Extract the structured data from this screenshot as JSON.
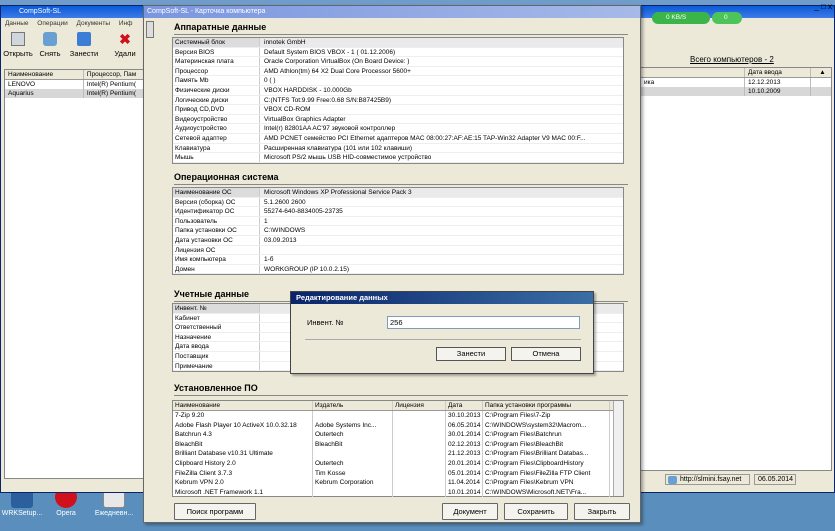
{
  "desktop": {
    "icons": [
      {
        "label": "WRKSetup...",
        "color": "#2c5f9e",
        "icon": "setup-icon"
      },
      {
        "label": "Opera",
        "color": "#d0101a",
        "icon": "opera-icon"
      },
      {
        "label": "Ежедневн...",
        "color": "#e8e8e8",
        "icon": "notepad-icon"
      }
    ]
  },
  "main": {
    "title": "CompSoft-SL",
    "menu": [
      "Данные",
      "Операции",
      "Документы",
      "Инф"
    ],
    "toolbar": [
      "Открыть",
      "Снять",
      "Занести",
      "Удали"
    ],
    "grid": {
      "headers": [
        "Наименование",
        "Процессор, Пам"
      ],
      "rows": [
        [
          "LENOVO",
          "Intel(R) Pentium("
        ],
        [
          "Aquarius",
          "Intel(R) Pentium("
        ]
      ]
    },
    "right_grid": {
      "headers": [
        "",
        "Дата ввода"
      ],
      "rows": [
        [
          "ика",
          "12.12.2013"
        ],
        [
          "",
          "10.10.2009"
        ]
      ]
    },
    "speed": "0 KB/S",
    "speed2": "0",
    "total_link": "Всего компьютеров - 2",
    "status_url": "http://slmini.fsay.net",
    "status_date": "06.05.2014",
    "window_controls": "_ □ x"
  },
  "card": {
    "title": "CompSoft-SL - Карточка компьютера",
    "hardware": {
      "title": "Аппаратные данные",
      "rows": [
        [
          "Системный блок",
          "innotek GmbH"
        ],
        [
          "Версия BIOS",
          "Default System BIOS VBOX  - 1 ( 01.12.2006)"
        ],
        [
          "Материнская плата",
          "Oracle Corporation VirtualBox (On Board Device: )"
        ],
        [
          "Процессор",
          "AMD Athlon(tm) 64 X2 Dual Core Processor 5600+"
        ],
        [
          "Память Mb",
          "0 ( )"
        ],
        [
          "Физические диски",
          "VBOX HARDDISK - 10.000Gb"
        ],
        [
          "Логические диски",
          "C:(NTFS Tot:9.99 Free:0.68 S/N:B87425B9)"
        ],
        [
          "Привод CD,DVD",
          "VBOX CD-ROM"
        ],
        [
          "Видеоустройство",
          "VirtualBox Graphics Adapter"
        ],
        [
          "Аудиоустройство",
          "Intel(r) 82801AA AC'97 звуковой контроллер"
        ],
        [
          "Сетевой адаптер",
          "AMD PCNET семейство PCI Ethernet адаптеров MAC 08:00:27:AF:AE:15  TAP-Win32 Adapter V9 MAC 00:F..."
        ],
        [
          "Клавиатура",
          "Расширенная клавиатура (101 или 102 клавиши)"
        ],
        [
          "Мышь",
          "Microsoft PS/2 мышь  USB HID-совместимое устройство"
        ]
      ]
    },
    "os": {
      "title": "Операционная система",
      "rows": [
        [
          "Наименование ОС",
          "Microsoft Windows XP Professional Service Pack 3"
        ],
        [
          "Версия (сборка) ОС",
          "5.1.2600 2600"
        ],
        [
          "Идентификатор ОС",
          "55274-640-8834005-23735"
        ],
        [
          "Пользователь",
          "1"
        ],
        [
          "Папка установки ОС",
          "C:\\WINDOWS"
        ],
        [
          "Дата установки ОС",
          "03.09.2013"
        ],
        [
          "Лицензия ОС",
          ""
        ],
        [
          "Имя компьютера",
          "1-б"
        ],
        [
          "Домен",
          "WORKGROUP (IP 10.0.2.15)"
        ]
      ]
    },
    "account": {
      "title": "Учетные данные",
      "rows": [
        [
          "Инвент. №",
          ""
        ],
        [
          "Кабинет",
          ""
        ],
        [
          "Ответственный",
          ""
        ],
        [
          "Назначение",
          ""
        ],
        [
          "Дата ввода",
          ""
        ],
        [
          "Поставщик",
          ""
        ],
        [
          "Примечание",
          ""
        ]
      ]
    },
    "software": {
      "title": "Установленное ПО",
      "headers": [
        "Наименование",
        "Издатель",
        "Лицензия",
        "Дата",
        "Папка установки программы"
      ],
      "rows": [
        [
          "7-Zip 9.20",
          "",
          "",
          "30.10.2013",
          "C:\\Program Files\\7-Zip"
        ],
        [
          "Adobe Flash Player 10 ActiveX 10.0.32.18",
          "Adobe Systems Inc...",
          "",
          "06.05.2014",
          "C:\\WINDOWS\\system32\\Macrom..."
        ],
        [
          "Batchrun 4.3",
          "Outertech",
          "",
          "30.01.2014",
          "C:\\Program Files\\Batchrun"
        ],
        [
          "BleachBit",
          "BleachBit",
          "",
          "02.12.2013",
          "C:\\Program Files\\BleachBit"
        ],
        [
          "Brilliant Database v10.31 Ultimate",
          "",
          "",
          "21.12.2013",
          "C:\\Program Files\\Brilliant Databas..."
        ],
        [
          "Clipboard History 2.0",
          "Outertech",
          "",
          "20.01.2014",
          "C:\\Program Files\\ClipboardHistory"
        ],
        [
          "FileZilla Client 3.7.3",
          "Tim Kosse",
          "",
          "05.01.2014",
          "C:\\Program Files\\FileZilla FTP Client"
        ],
        [
          "Kebrum VPN 2.0",
          "Kebrum Corporation",
          "",
          "11.04.2014",
          "C:\\Program Files\\Kebrum VPN"
        ],
        [
          "Microsoft .NET Framework 1.1",
          "",
          "",
          "10.01.2014",
          "C:\\WINDOWS\\Microsoft.NET\\Fra..."
        ]
      ]
    },
    "buttons": {
      "search": "Поиск программ",
      "document": "Документ",
      "save": "Сохранить",
      "close": "Закрыть"
    }
  },
  "dialog": {
    "title": "Редактирование данных",
    "label": "Инвент. №",
    "value": "256",
    "ok": "Занести",
    "cancel": "Отмена"
  }
}
